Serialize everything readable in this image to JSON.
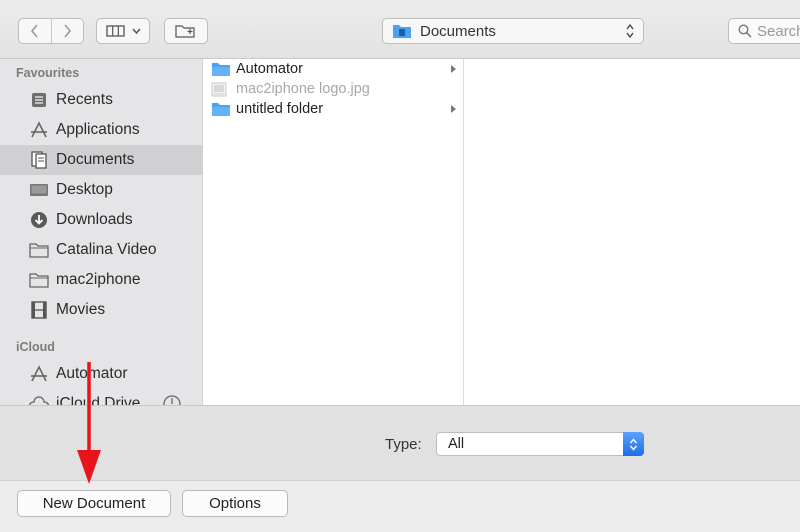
{
  "toolbar": {
    "location": "Documents",
    "search_placeholder": "Search"
  },
  "sidebar": {
    "favourites_header": "Favourites",
    "favourites": [
      {
        "label": "Recents",
        "icon": "recents-icon"
      },
      {
        "label": "Applications",
        "icon": "applications-icon"
      },
      {
        "label": "Documents",
        "icon": "documents-icon",
        "selected": true
      },
      {
        "label": "Desktop",
        "icon": "desktop-icon"
      },
      {
        "label": "Downloads",
        "icon": "downloads-icon"
      },
      {
        "label": "Catalina Video",
        "icon": "folder-icon"
      },
      {
        "label": "mac2iphone",
        "icon": "folder-icon"
      },
      {
        "label": "Movies",
        "icon": "movies-icon"
      }
    ],
    "icloud_header": "iCloud",
    "icloud": [
      {
        "label": "Automator",
        "icon": "automator-icon"
      },
      {
        "label": "iCloud Drive",
        "icon": "cloud-icon"
      }
    ]
  },
  "browser": {
    "items": [
      {
        "name": "Automator",
        "kind": "folder",
        "dim": false,
        "has_children": true
      },
      {
        "name": "mac2iphone logo.jpg",
        "kind": "image",
        "dim": true,
        "has_children": false
      },
      {
        "name": "untitled folder",
        "kind": "folder",
        "dim": false,
        "has_children": true
      }
    ]
  },
  "footer": {
    "type_label": "Type:",
    "type_value": "All",
    "new_document_label": "New Document",
    "options_label": "Options"
  },
  "colors": {
    "accent_blue": "#1c6fe8",
    "folder_blue": "#4aa3f0",
    "annotation_red": "#e8141b",
    "sidebar_selected": "#d0d0d3"
  }
}
